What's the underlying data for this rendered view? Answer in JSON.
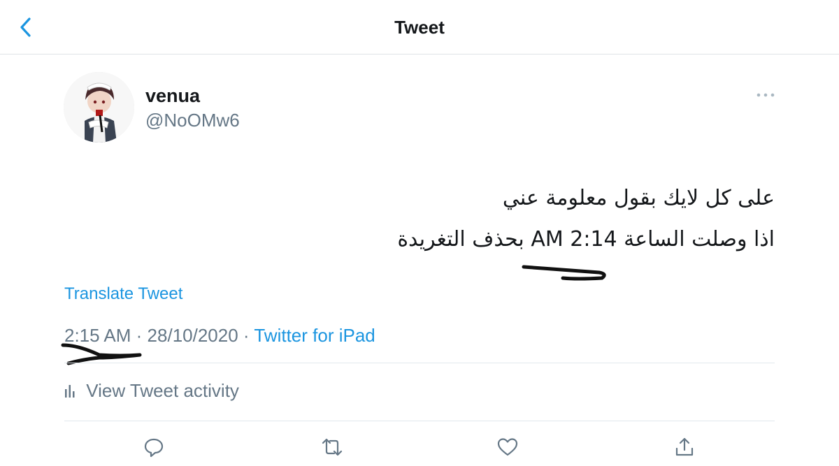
{
  "header": {
    "title": "Tweet"
  },
  "tweet": {
    "author": {
      "display_name": "venua",
      "handle": "@NoOMw6"
    },
    "text_lines": [
      "على كل لايك بقول معلومة عني",
      "اذا وصلت الساعة AM 2:14 بحذف التغريدة"
    ],
    "translate_label": "Translate Tweet",
    "time": "2:15 AM",
    "date": "28/10/2020",
    "separator": "·",
    "source": "Twitter for iPad",
    "activity_label": "View Tweet activity"
  },
  "icons": {
    "back": "chevron-left-icon",
    "more": "more-horizontal-icon",
    "activity": "bar-chart-icon",
    "reply": "reply-icon",
    "retweet": "retweet-icon",
    "like": "heart-icon",
    "share": "share-icon"
  },
  "colors": {
    "accent": "#1b95e0",
    "secondary_text": "#657786",
    "divider": "#e1e8ed",
    "ink": "#111111"
  }
}
